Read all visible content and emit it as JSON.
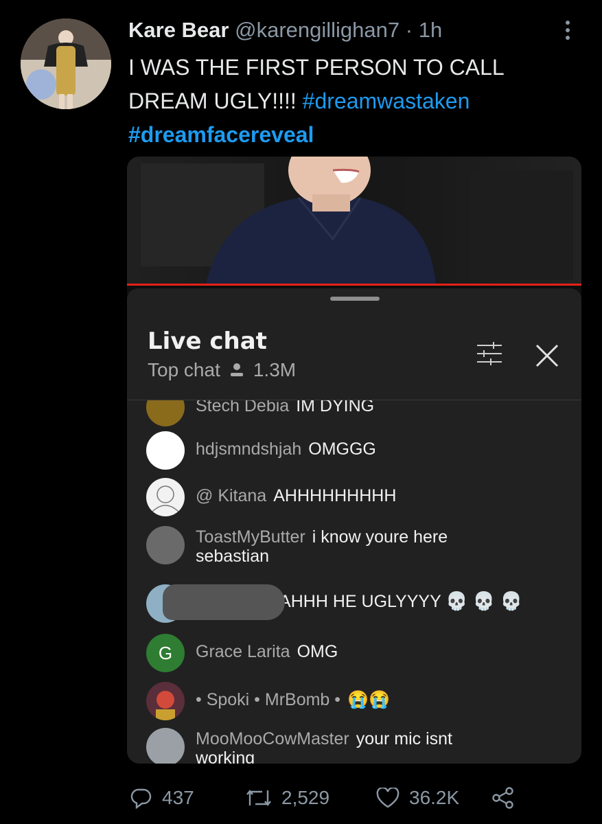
{
  "tweet": {
    "display_name": "Kare Bear",
    "handle": "@karengillighan7",
    "separator": "·",
    "time": "1h",
    "text_lines": [
      "I WAS THE FIRST PERSON TO CALL",
      "DREAM UGLY!!!! "
    ],
    "hashtag_1": "#dreamwastaken",
    "hashtag_2": "#dreamfacereveal"
  },
  "live_chat": {
    "title": "Live chat",
    "mode": "Top chat",
    "viewers": "1.3M",
    "messages": [
      {
        "author": "Stech Debia",
        "text": "IM DYING"
      },
      {
        "author": "hdjsmndshjah",
        "text": "OMGGG"
      },
      {
        "author": "@ Kitana",
        "text": "AHHHHHHHHH"
      },
      {
        "author": "ToastMyButter",
        "text": "i know youre here sebastian"
      },
      {
        "author": "",
        "text": "NAHHH HE UGLYYYY"
      },
      {
        "author": "Grace Larita",
        "text": "OMG",
        "avatar_letter": "G"
      },
      {
        "author": "• Spoki • MrBomb •",
        "text": "😭😭"
      },
      {
        "author": "MooMooCowMaster",
        "text": "your mic isnt working"
      }
    ]
  },
  "actions": {
    "replies": "437",
    "retweets": "2,529",
    "likes": "36.2K"
  },
  "colors": {
    "background": "#000000",
    "link": "#1d9bf0",
    "muted": "#8b98a5",
    "chat_bg": "#212121",
    "progress": "#e62117",
    "grace_avatar": "#2e7d32"
  }
}
